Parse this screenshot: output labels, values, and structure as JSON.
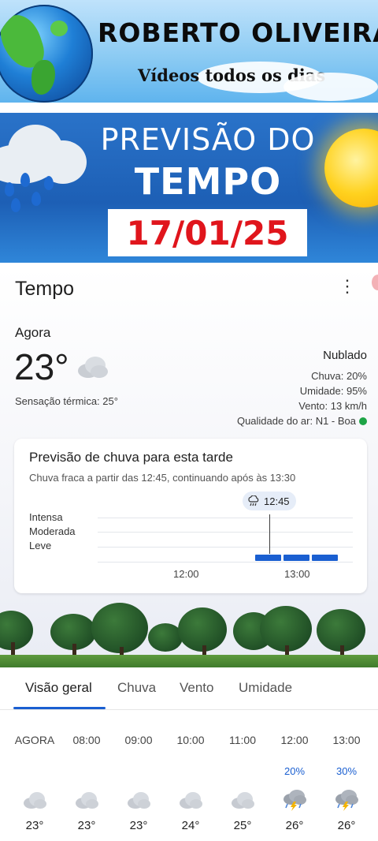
{
  "channel": {
    "name": "ROBERTO OLIVEIRA",
    "tagline": "Vídeos todos os dias"
  },
  "forecast_banner": {
    "line1": "PREVISÃO DO",
    "line2": "TEMPO",
    "date": "17/01/25",
    "date_color": "#e0151c"
  },
  "weather": {
    "title": "Tempo",
    "menu_icon": "more-vert-icon",
    "now": {
      "label": "Agora",
      "temperature": "23°",
      "icon": "cloud-icon",
      "feels_like": "Sensação térmica: 25°"
    },
    "condition": "Nublado",
    "stats": {
      "rain": "Chuva: 20%",
      "humidity": "Umidade: 95%",
      "wind": "Vento: 13 km/h",
      "air_quality": "Qualidade do ar: N1 - Boa",
      "air_quality_color": "#1ea446"
    },
    "rain_card": {
      "title": "Previsão de chuva para esta tarde",
      "subtitle": "Chuva fraca a partir das 12:45, continuando após às 13:30",
      "levels": [
        "Intensa",
        "Moderada",
        "Leve"
      ],
      "marker_time": "12:45",
      "marker_icon": "rain-cloud-icon",
      "ticks": [
        "12:00",
        "13:00"
      ],
      "bar_color": "#1a5fd1"
    },
    "tabs": [
      {
        "label": "Visão geral",
        "active": true
      },
      {
        "label": "Chuva",
        "active": false
      },
      {
        "label": "Vento",
        "active": false
      },
      {
        "label": "Umidade",
        "active": false
      }
    ],
    "hourly": [
      {
        "time": "AGORA",
        "precip": "",
        "icon": "cloud-icon",
        "temp": "23°"
      },
      {
        "time": "08:00",
        "precip": "",
        "icon": "cloud-icon",
        "temp": "23°"
      },
      {
        "time": "09:00",
        "precip": "",
        "icon": "cloud-icon",
        "temp": "23°"
      },
      {
        "time": "10:00",
        "precip": "",
        "icon": "cloud-icon",
        "temp": "24°"
      },
      {
        "time": "11:00",
        "precip": "",
        "icon": "cloud-icon",
        "temp": "25°"
      },
      {
        "time": "12:00",
        "precip": "20%",
        "icon": "thunderstorm-icon",
        "temp": "26°"
      },
      {
        "time": "13:00",
        "precip": "30%",
        "icon": "thunderstorm-icon",
        "temp": "26°"
      }
    ]
  }
}
